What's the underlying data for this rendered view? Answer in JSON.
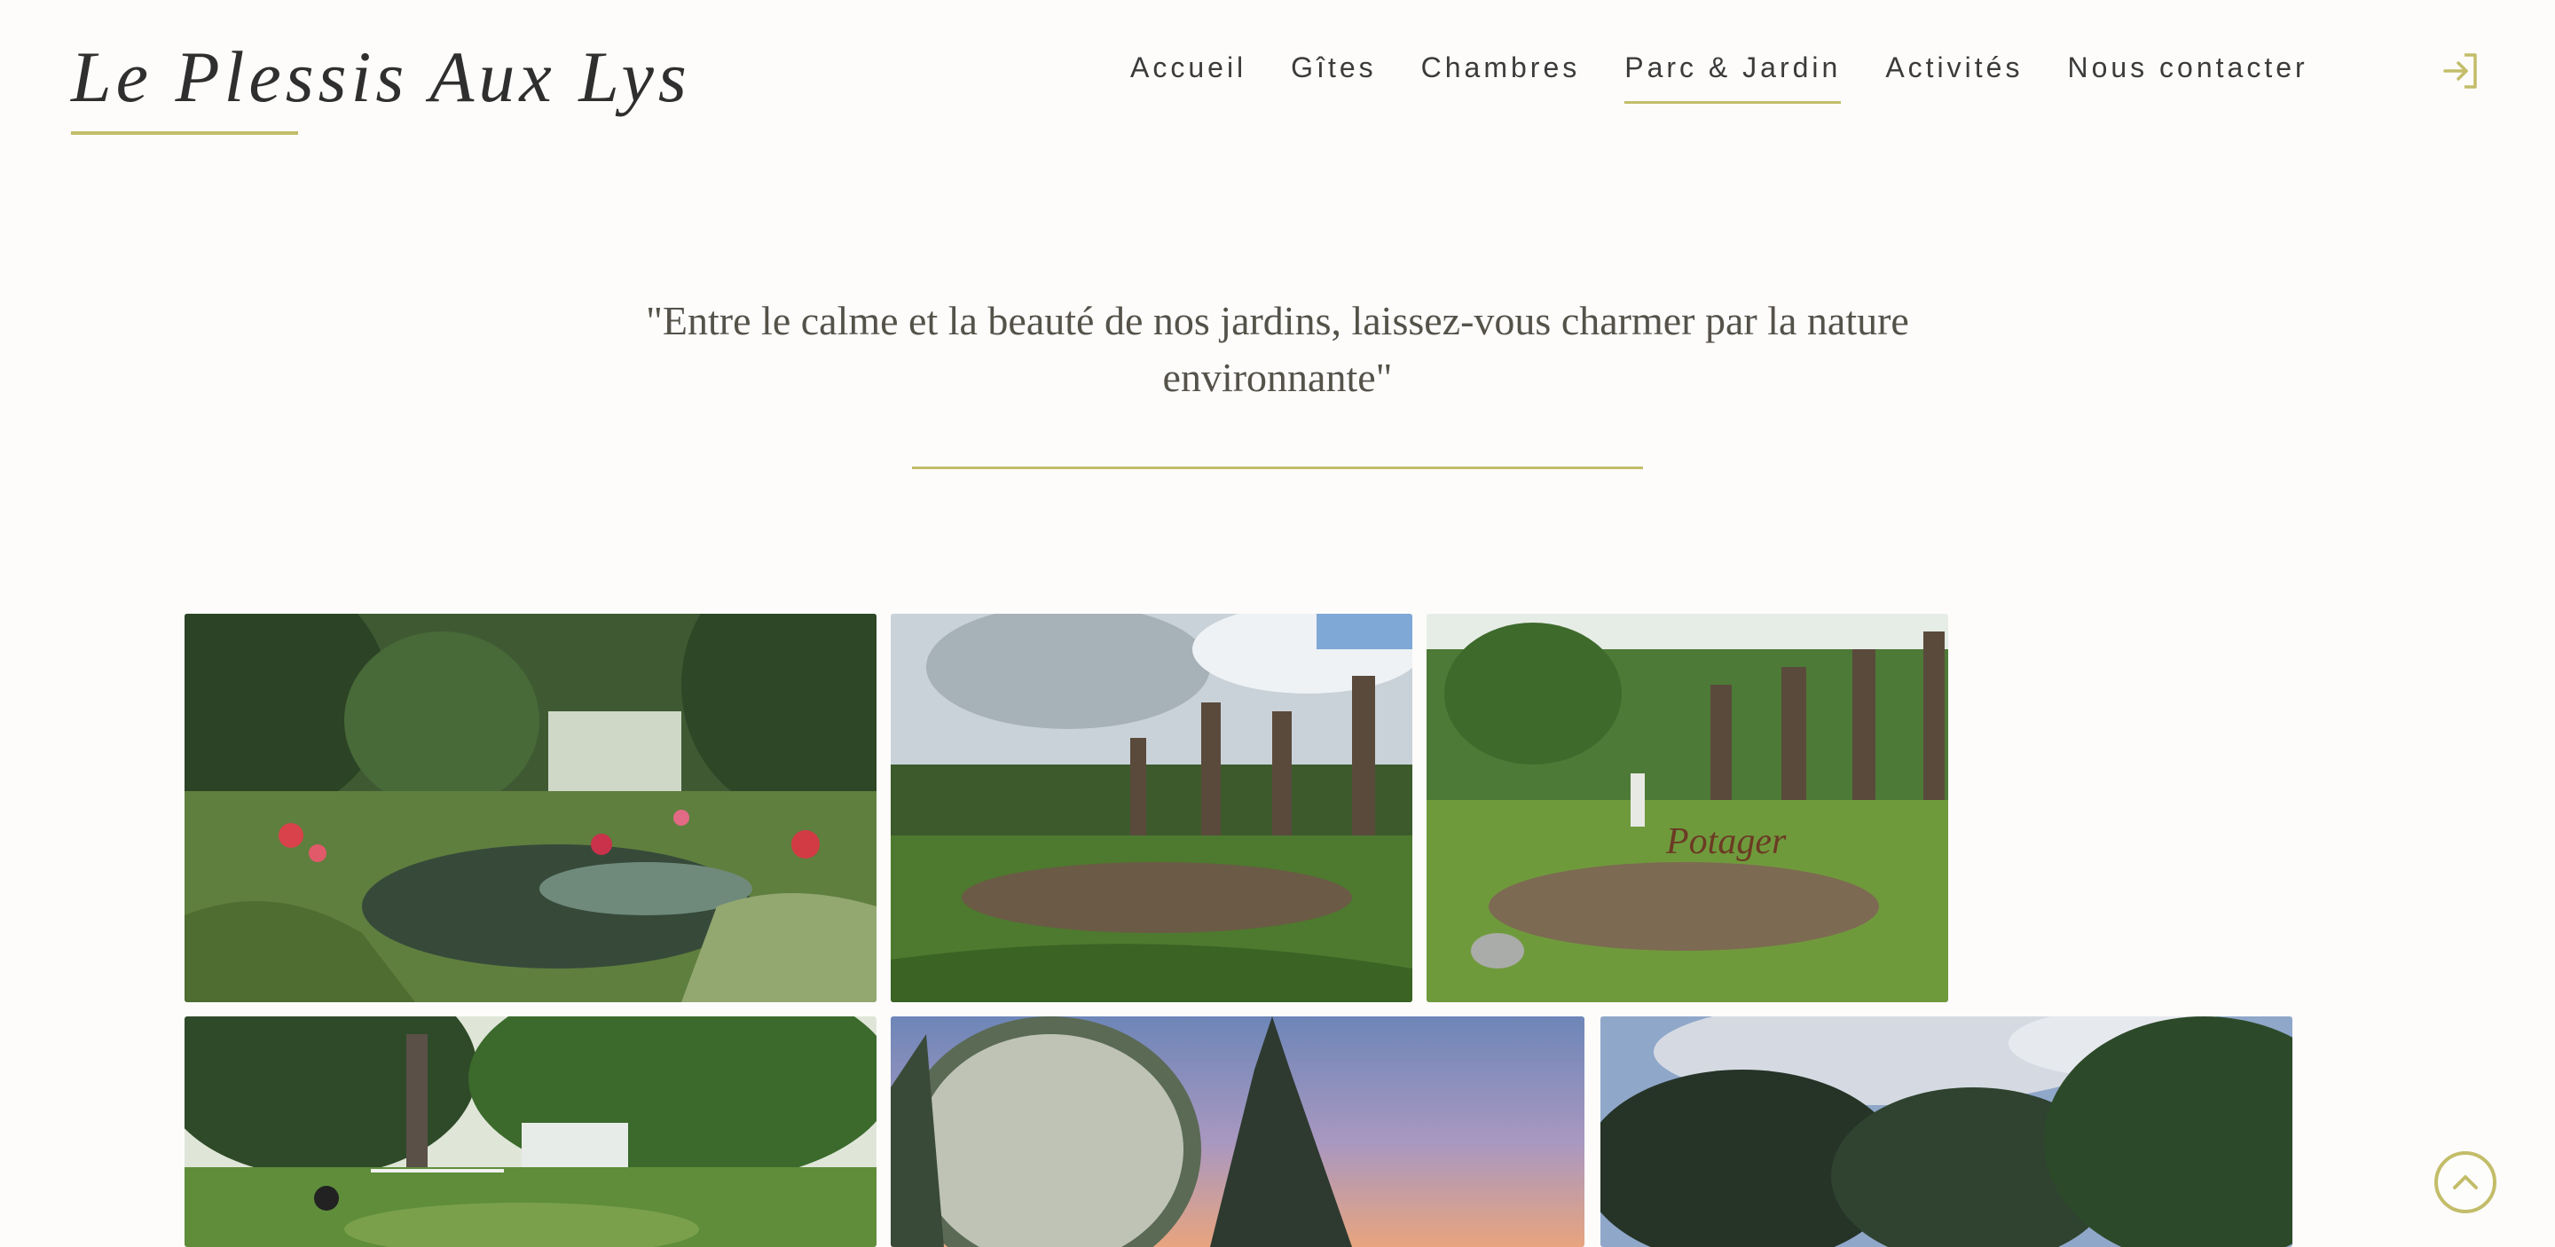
{
  "brand": {
    "name": "Le Plessis Aux Lys",
    "accent_color": "#c3bd6a"
  },
  "nav": {
    "items": [
      {
        "label": "Accueil",
        "active": false
      },
      {
        "label": "Gîtes",
        "active": false
      },
      {
        "label": "Chambres",
        "active": false
      },
      {
        "label": "Parc & Jardin",
        "active": true
      },
      {
        "label": "Activités",
        "active": false
      },
      {
        "label": "Nous contacter",
        "active": false
      }
    ],
    "login_icon": "login-arrow-icon"
  },
  "hero": {
    "quote": "\"Entre le calme et la beauté de nos jardins, laissez-vous charmer par la nature environnante\""
  },
  "gallery": {
    "photos": [
      {
        "name": "pond-flowers-photo"
      },
      {
        "name": "pollarded-trees-garden-photo"
      },
      {
        "name": "potager-sign-photo"
      },
      {
        "name": "park-lawn-trees-photo"
      },
      {
        "name": "flowering-tree-sunset-photo"
      },
      {
        "name": "cedar-trees-sky-photo"
      }
    ]
  },
  "scroll_top_icon": "chevron-up-icon"
}
